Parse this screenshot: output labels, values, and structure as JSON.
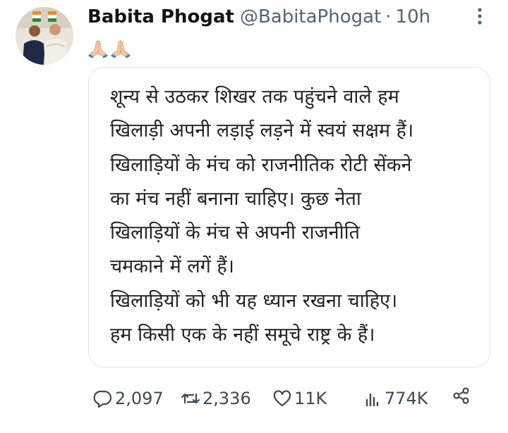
{
  "tweet": {
    "display_name": "Babita Phogat",
    "handle": "@BabitaPhogat",
    "separator": "·",
    "time": "10h",
    "emoji_text": "🙏🏻🙏🏻",
    "avatar_icon": "profile-photo",
    "more_icon": "more-vertical-icon"
  },
  "card": {
    "lines": [
      "शून्य से उठकर शिखर तक पहुंचने वाले हम",
      "खिलाड़ी अपनी लड़ाई लड़ने में स्वयं सक्षम हैं।",
      "खिलाड़ियों के मंच को राजनीतिक रोटी सेंकने",
      "का मंच नहीं बनाना चाहिए। कुछ नेता",
      "खिलाड़ियों के मंच से अपनी राजनीति",
      "चमकाने में लगें हैं।",
      "खिलाड़ियों को भी यह ध्यान रखना चाहिए।",
      "हम किसी एक के नहीं समूचे राष्ट्र के हैं।"
    ]
  },
  "actions": {
    "replies": "2,097",
    "retweets": "2,336",
    "likes": "11K",
    "views": "774K"
  },
  "colors": {
    "text": "#0f1419",
    "muted": "#536471",
    "border": "#dfe3e8"
  }
}
